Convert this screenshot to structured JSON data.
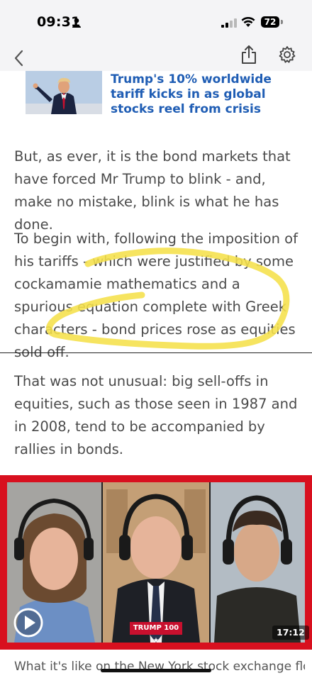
{
  "status_bar": {
    "time": "09:31",
    "battery": "72"
  },
  "nav": {
    "back_icon": "chevron-left-icon",
    "share_icon": "share-icon",
    "settings_icon": "gear-icon"
  },
  "related_story": {
    "title": "Trump's 10% worldwide tariff kicks in as global stocks reel from crisis"
  },
  "article": {
    "paragraphs": [
      "But, as ever, it is the bond markets that have forced Mr Trump to blink - and, make no mistake, blink is what he has done.",
      "To begin with, following the imposition of his tariffs - which were justified by some cockamamie mathematics and a spurious equation complete with Greek characters - bond prices rose as equities sold off.",
      "That was not unusual: big sell-offs in equities, such as those seen in 1987 and in 2008, tend to be accompanied by rallies in bonds."
    ],
    "highlight_color": "#f5e04a"
  },
  "video": {
    "duration": "17:12",
    "badge": "TRUMP 100 ★",
    "accent_color": "#d8101f"
  },
  "caption": "What it's like on the New York stock exchange floor"
}
